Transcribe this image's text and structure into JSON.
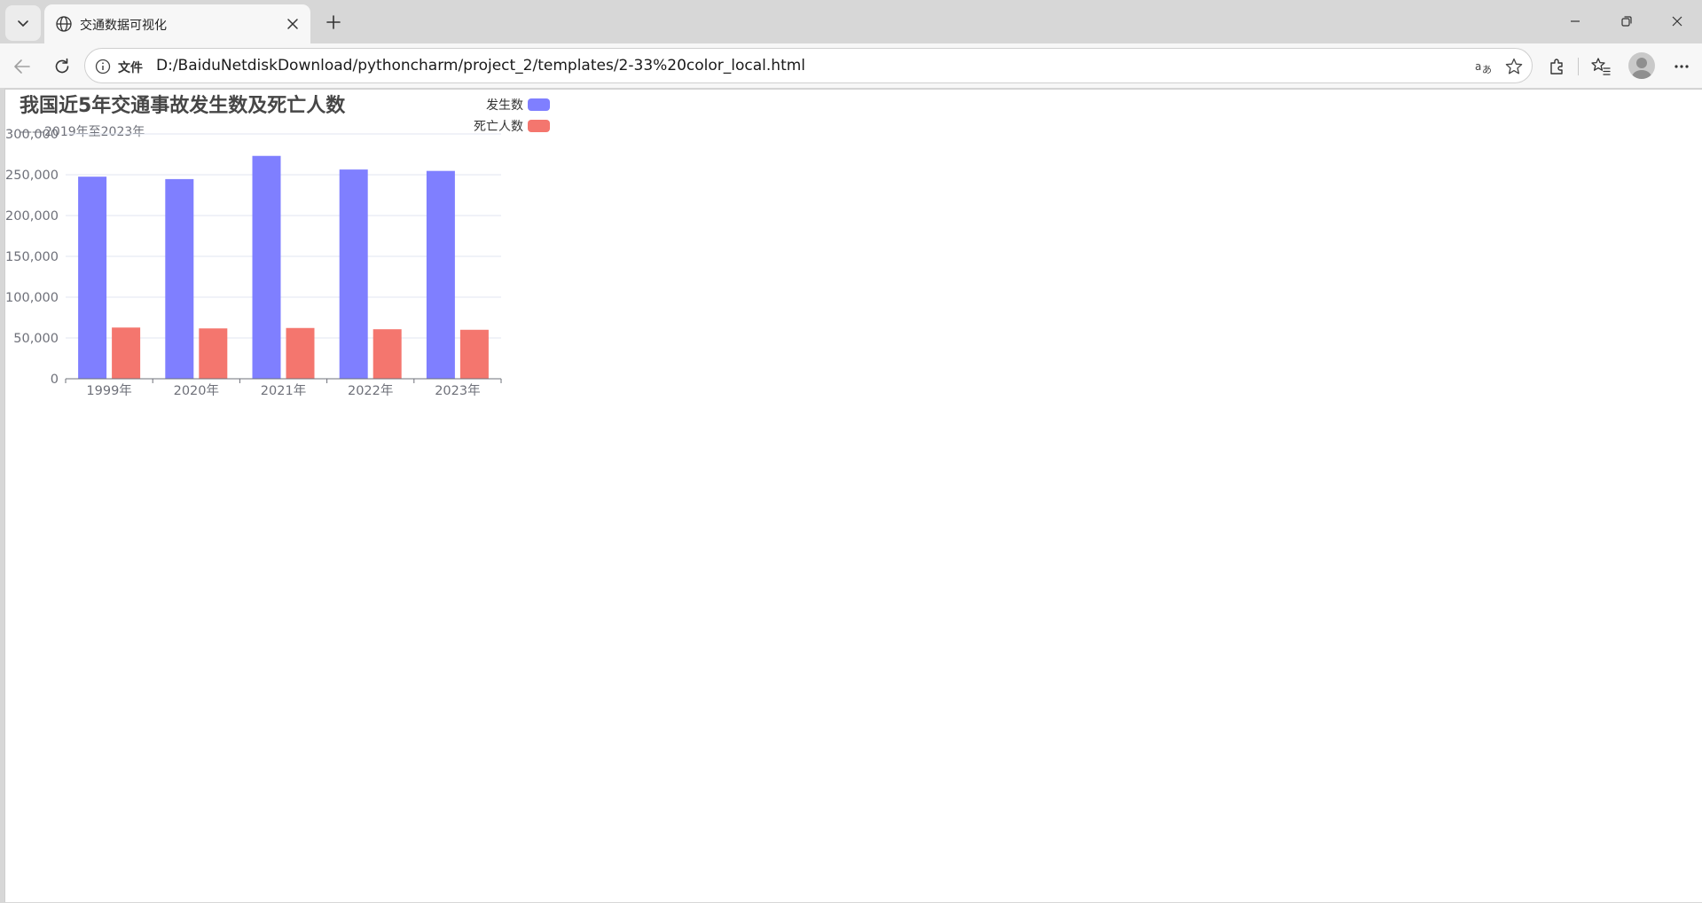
{
  "browser": {
    "tab_title": "交通数据可视化",
    "address_label": "文件",
    "url": "D:/BaiduNetdiskDownload/pythoncharm/project_2/templates/2-33%20color_local.html",
    "icons": [
      "chevron-down-icon",
      "globe-icon",
      "close-icon",
      "plus-icon",
      "minimize-icon",
      "restore-icon",
      "window-close-icon",
      "back-icon",
      "refresh-icon",
      "info-icon",
      "read-aloud-icon",
      "star-icon",
      "extensions-icon",
      "favorites-icon",
      "avatar",
      "more-icon"
    ]
  },
  "chart_data": {
    "type": "bar",
    "title": "我国近5年交通事故发生数及死亡人数",
    "subtitle": "——2019年至2023年",
    "categories": [
      "1999年",
      "2020年",
      "2021年",
      "2022年",
      "2023年"
    ],
    "series": [
      {
        "name": "发生数",
        "color": "#7f7fff",
        "values": [
          247646,
          244674,
          273098,
          256409,
          254703
        ]
      },
      {
        "name": "死亡人数",
        "color": "#f4766e",
        "values": [
          62763,
          61703,
          62218,
          60676,
          60028
        ]
      }
    ],
    "ylim": [
      0,
      300000
    ],
    "yticks": [
      0,
      50000,
      100000,
      150000,
      200000,
      250000,
      300000
    ],
    "ytick_labels": [
      "0",
      "50,000",
      "100,000",
      "150,000",
      "200,000",
      "250,000",
      "300,000"
    ],
    "grid": true,
    "legend_position": "top"
  }
}
